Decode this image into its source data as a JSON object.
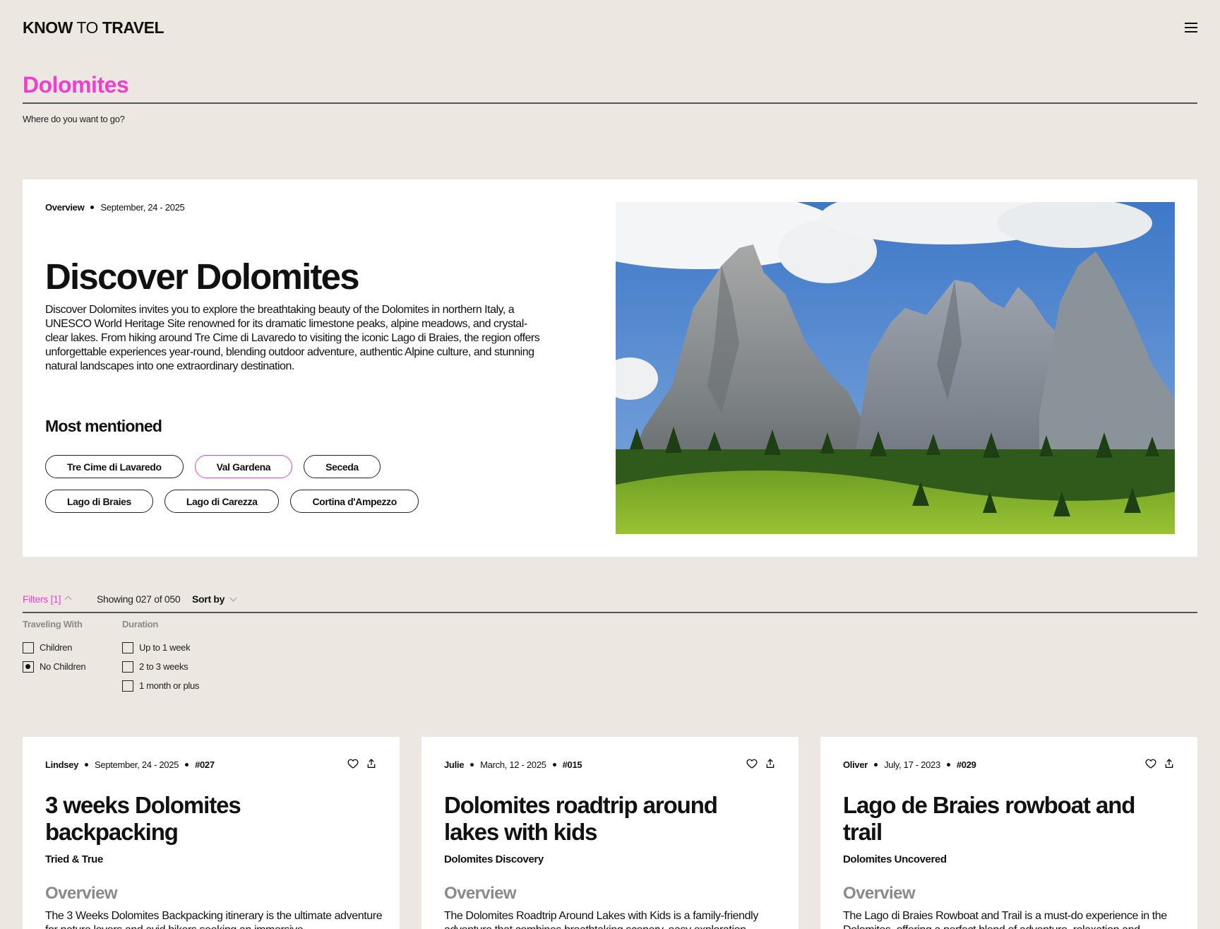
{
  "header": {
    "logo_know": "KNOW",
    "logo_to": "TO",
    "logo_travel": "TRAVEL"
  },
  "search": {
    "value": "Dolomites",
    "hint": "Where do you want to go?"
  },
  "hero": {
    "kind": "Overview",
    "date": "September, 24 - 2025",
    "title": "Discover Dolomites",
    "description": "Discover Dolomites invites you to explore the breathtaking beauty of the Dolomites in northern Italy, a UNESCO World Heritage Site renowned for its dramatic limestone peaks, alpine meadows, and crystal-clear lakes. From hiking around Tre Cime di Lavaredo to visiting the iconic Lago di Braies, the region offers unforgettable experiences year-round, blending outdoor adventure, authentic Alpine culture, and stunning natural landscapes into one extraordinary destination.",
    "most_mentioned_title": "Most mentioned",
    "chips": [
      "Tre Cime di Lavaredo",
      "Val Gardena",
      "Seceda",
      "Lago di Braies",
      "Lago di Carezza",
      "Cortina d'Ampezzo"
    ],
    "active_chip": "Val Gardena",
    "accent": "#EE3FCF"
  },
  "filterbar": {
    "filters_label": "Filters [1]",
    "showing": "Showing 027 of 050",
    "sort_label": "Sort by"
  },
  "filters": {
    "traveling_with": {
      "title": "Traveling With",
      "options": [
        {
          "label": "Children",
          "checked": false
        },
        {
          "label": "No Children",
          "checked": true
        }
      ]
    },
    "duration": {
      "title": "Duration",
      "options": [
        {
          "label": "Up to 1 week",
          "checked": false
        },
        {
          "label": "2 to 3 weeks",
          "checked": false
        },
        {
          "label": "1 month or plus",
          "checked": false
        }
      ]
    }
  },
  "cards": [
    {
      "author": "Lindsey",
      "date": "September, 24 - 2025",
      "number": "#027",
      "title": "3 weeks Dolomites backpacking",
      "subtitle": "Tried & True",
      "overview_label": "Overview",
      "text": "The 3 Weeks Dolomites Backpacking itinerary is the ultimate adventure for nature lovers and avid hikers seeking an immersive"
    },
    {
      "author": "Julie",
      "date": "March, 12 - 2025",
      "number": "#015",
      "title": "Dolomites roadtrip around lakes with kids",
      "subtitle": "Dolomites Discovery",
      "overview_label": "Overview",
      "text": "The Dolomites Roadtrip Around Lakes with Kids is a family-friendly adventure that combines breathtaking scenery, easy exploration"
    },
    {
      "author": "Oliver",
      "date": "July, 17 - 2023",
      "number": "#029",
      "title": "Lago de Braies rowboat and trail",
      "subtitle": "Dolomites Uncovered",
      "overview_label": "Overview",
      "text": "The Lago di Braies Rowboat and Trail is a must-do experience in the Dolomites, offering a perfect blend of adventure, relaxation and"
    }
  ],
  "icons": {
    "menu": "hamburger-menu-icon",
    "heart": "heart-icon",
    "share": "share-icon"
  }
}
